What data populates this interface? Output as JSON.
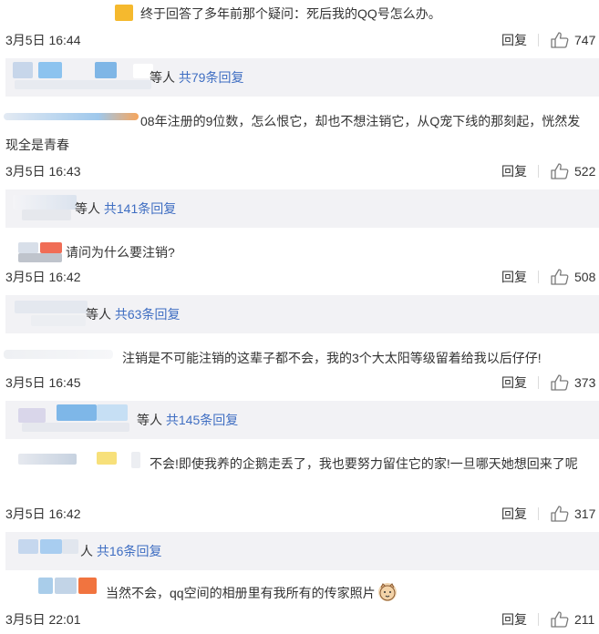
{
  "comments": [
    {
      "text": "终于回答了多年前那个疑问：死后我的QQ号怎么办。",
      "date": "3月5日 16:44",
      "reply": "回复",
      "likes": "747",
      "sub": {
        "prefix": "等人",
        "link": "共79条回复"
      }
    },
    {
      "text": "08年注册的9位数，怎么恨它，却也不想注销它，从Q宠下线的那刻起，恍然发现全是青春",
      "date": "3月5日 16:43",
      "reply": "回复",
      "likes": "522",
      "sub": {
        "prefix": "等人",
        "link": "共141条回复"
      }
    },
    {
      "text": "请问为什么要注销?",
      "date": "3月5日 16:42",
      "reply": "回复",
      "likes": "508",
      "sub": {
        "prefix": "等人",
        "link": "共63条回复"
      }
    },
    {
      "text": "注销是不可能注销的这辈子都不会，我的3个大太阳等级留着给我以后仔仔!",
      "date": "3月5日 16:45",
      "reply": "回复",
      "likes": "373",
      "sub": {
        "prefix": "等人",
        "link": "共145条回复"
      }
    },
    {
      "text": "不会!即使我养的企鹅走丢了，我也要努力留住它的家!一旦哪天她想回来了呢",
      "date": "3月5日 16:42",
      "reply": "回复",
      "likes": "317",
      "sub": {
        "prefix": "人",
        "link": "共16条回复"
      }
    },
    {
      "text": "当然不会，qq空间的相册里有我所有的传家照片",
      "date": "3月5日 22:01",
      "reply": "回复",
      "likes": "211"
    }
  ],
  "icons": {
    "like": "thumbs-up-icon",
    "emoji": "cat-face-emoji"
  },
  "colors": {
    "link": "#3f6ec2",
    "subbox_bg": "#f2f2f5",
    "text": "#333333"
  }
}
